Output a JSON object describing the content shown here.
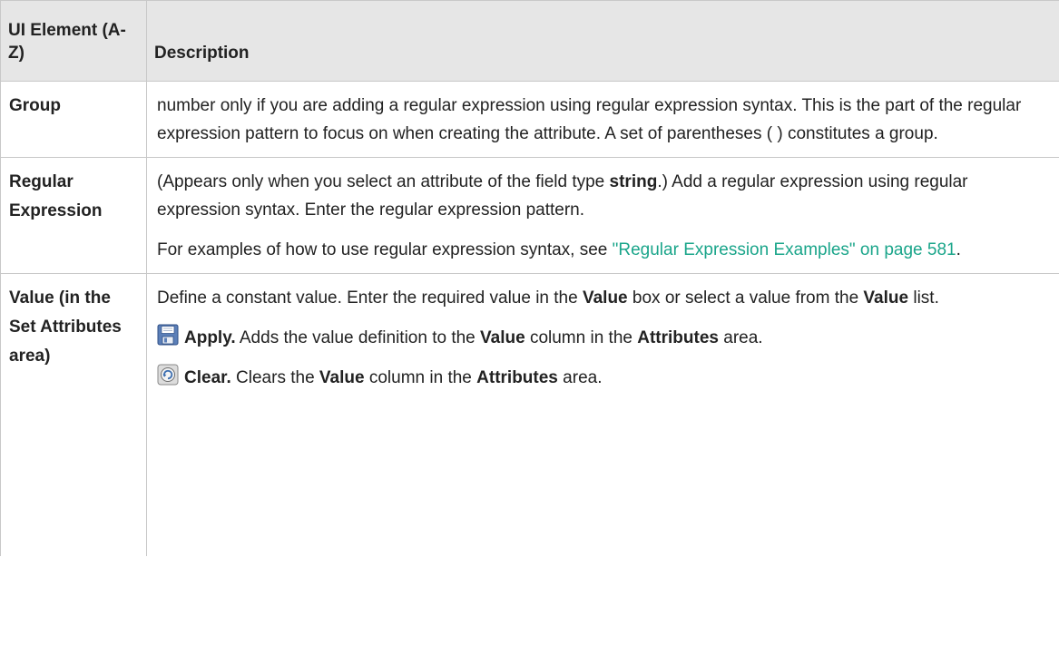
{
  "header": {
    "col_element": "UI Element (A-Z)",
    "col_description": "Description"
  },
  "rows": [
    {
      "element": "Group",
      "description": "number only if you are adding a regular expression using regular expression syntax. This is the part of the regular expression pattern to focus on when creating the attribute. A set of parentheses ( ) constitutes a group."
    },
    {
      "element": "Regular Expression",
      "para1_a": "(Appears only when you select an attribute of the field type ",
      "para1_bold": "string",
      "para1_b": ".) Add a regular expression using regular expression syntax. Enter the regular expression pattern.",
      "para2_a": "For examples of how to use regular expression syntax, see ",
      "para2_link": "\"Regular Expression Examples\" on page 581",
      "para2_b": "."
    },
    {
      "element": "Value (in the Set Attributes area)",
      "para1_a": "Define a constant value. Enter the required value in the ",
      "para1_bold1": "Value",
      "para1_b": " box or select a value from the ",
      "para1_bold2": "Value",
      "para1_c": " list.",
      "apply": {
        "icon": "save-disk-icon",
        "label": "Apply.",
        "text_a": " Adds the value definition to the ",
        "bold1": "Value",
        "text_b": " column in the ",
        "bold2": "Attributes",
        "text_c": " area."
      },
      "clear": {
        "icon": "clear-refresh-icon",
        "label": "Clear.",
        "text_a": " Clears the ",
        "bold1": "Value",
        "text_b": " column in the ",
        "bold2": "Attributes",
        "text_c": " area."
      }
    }
  ],
  "colors": {
    "header_bg": "#e6e6e6",
    "border": "#c8c8c8",
    "link": "#1aa58a"
  }
}
